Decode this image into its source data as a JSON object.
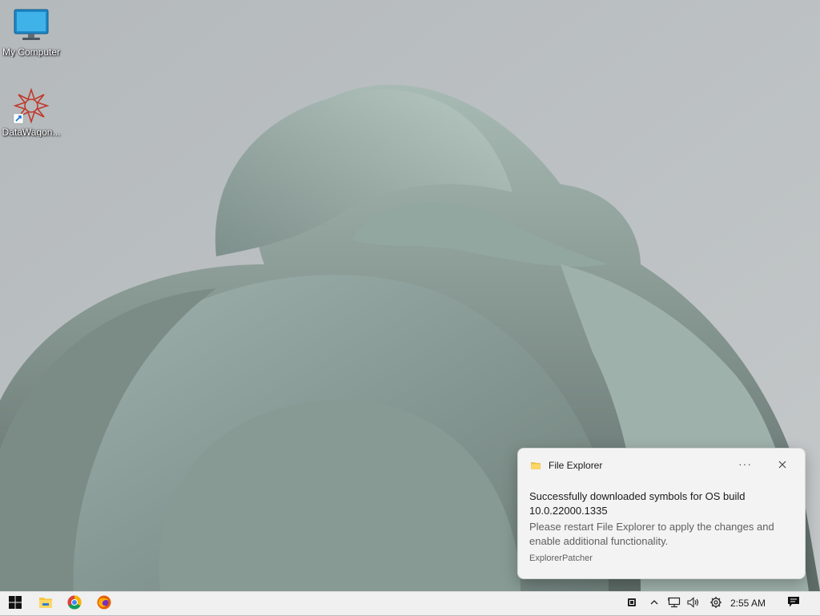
{
  "desktop": {
    "icons": [
      {
        "label": "My Computer",
        "icon": "monitor-icon"
      },
      {
        "label": "DataWagon...",
        "icon": "datawagon-app-icon"
      }
    ]
  },
  "notification": {
    "app_name": "File Explorer",
    "more_label": "···",
    "title": "Successfully downloaded symbols for OS build 10.0.22000.1335",
    "body": "Please restart File Explorer to apply the changes and enable additional functionality.",
    "attribution": "ExplorerPatcher"
  },
  "taskbar": {
    "pinned": [
      "start-icon",
      "file-explorer-icon",
      "chrome-icon",
      "firefox-icon"
    ],
    "tray_icons": [
      "tray-app-icon",
      "chevron-up-icon",
      "network-icon",
      "volume-icon",
      "settings-gear-icon"
    ],
    "clock": "2:55 AM",
    "notification_center": "action-center-icon"
  },
  "colors": {
    "wallpaper_bg": "#b9bec0",
    "petal": "#8fa39d",
    "taskbar": "#f0f0f0",
    "toast_bg": "#f3f3f3"
  }
}
